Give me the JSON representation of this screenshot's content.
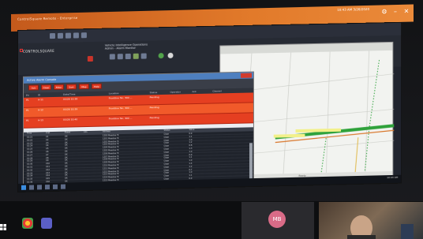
{
  "outer_window": {
    "title": "ControlSquare Remote - Enterprise",
    "right_text": "10:43 AM 3/26/2020"
  },
  "app": {
    "logo": "CONTROLSQUARE",
    "title_lines": [
      "Vehicle Intelligence Operations",
      "Admin - Alarm Monitor"
    ]
  },
  "alarm_window": {
    "title": "Active Alarm Console",
    "buttons": [
      "Ack",
      "Clear",
      "Filter",
      "Sort",
      "Map",
      "Help"
    ],
    "headers": [
      "Pri",
      "ID",
      "Date/Time",
      "Location",
      "Status",
      "Operator",
      "Ack",
      "Cleared"
    ],
    "rows": [
      {
        "pri": "P1",
        "id": "A-11",
        "time": "03/26 10:38",
        "loc": "Frontline Ter, 300 ...",
        "status": "Pending"
      },
      {
        "pri": "P1",
        "id": "A-12",
        "time": "03/26 10:39",
        "loc": "Frontline Ter, 300 ...",
        "status": "Pending"
      },
      {
        "pri": "P1",
        "id": "A-13",
        "time": "03/26 10:40",
        "loc": "Frontline Ter, 300 ...",
        "status": "Pending"
      }
    ],
    "lower_headers": [
      "Time",
      "Unit",
      "Event",
      "Info",
      "Address",
      "Status",
      "Value"
    ],
    "lower_rows": [
      [
        "10:21",
        "U1",
        "OK",
        "",
        "1200 Meadow Tc",
        "Clear",
        "0.9"
      ],
      [
        "10:22",
        "U2",
        "OK",
        "",
        "1201 Meadow Tc",
        "Clear",
        "1.1"
      ],
      [
        "10:23",
        "U3",
        "OK",
        "",
        "1202 Meadow Tc",
        "Clear",
        "1.0"
      ],
      [
        "10:24",
        "U4",
        "OK",
        "",
        "1203 Meadow Tc",
        "Clear",
        "1.2"
      ],
      [
        "10:25",
        "U5",
        "OK",
        "",
        "1204 Meadow Tc",
        "Clear",
        "0.8"
      ],
      [
        "10:26",
        "U6",
        "OK",
        "",
        "1205 Meadow Tc",
        "Clear",
        "1.3"
      ],
      [
        "10:27",
        "U7",
        "OK",
        "",
        "1206 Meadow Tc",
        "Clear",
        "1.0"
      ],
      [
        "10:28",
        "U8",
        "OK",
        "",
        "1207 Meadow Tc",
        "Clear",
        "0.9"
      ],
      [
        "10:29",
        "U9",
        "OK",
        "",
        "1208 Meadow Tc",
        "Clear",
        "1.1"
      ],
      [
        "10:30",
        "U10",
        "OK",
        "",
        "1209 Meadow Tc",
        "Clear",
        "1.0"
      ],
      [
        "10:31",
        "U11",
        "OK",
        "",
        "1210 Meadow Tc",
        "Clear",
        "1.4"
      ],
      [
        "10:32",
        "U12",
        "OK",
        "",
        "1211 Meadow Tc",
        "Clear",
        "1.2"
      ],
      [
        "10:33",
        "U13",
        "OK",
        "",
        "1212 Meadow Tc",
        "Clear",
        "0.7"
      ],
      [
        "10:34",
        "U14",
        "OK",
        "",
        "1213 Meadow Tc",
        "Clear",
        "1.0"
      ],
      [
        "10:35",
        "U15",
        "OK",
        "",
        "1214 Meadow Tc",
        "Clear",
        "1.1"
      ],
      [
        "10:36",
        "U16",
        "OK",
        "",
        "1215 Meadow Tc",
        "Clear",
        "0.9"
      ],
      [
        "10:37",
        "U17",
        "OK",
        "",
        "1216 Meadow Tc",
        "Clear",
        "1.0"
      ]
    ]
  },
  "map_status": "Ready",
  "taskbar_clock": "10:43 AM",
  "meeting": {
    "avatar_initials": "MB"
  }
}
